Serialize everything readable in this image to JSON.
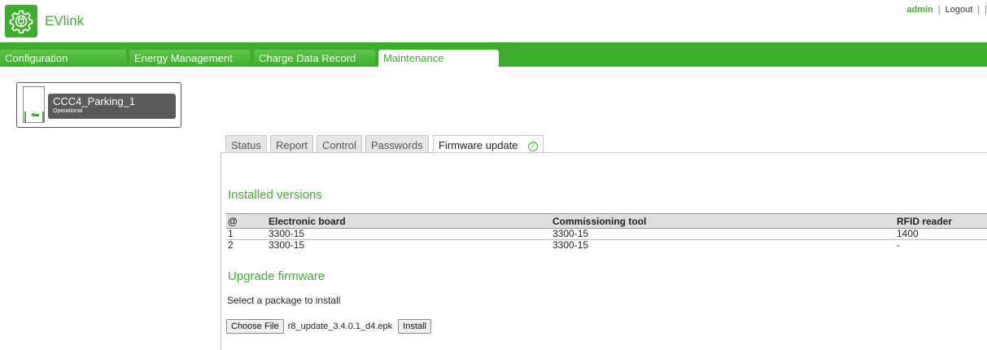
{
  "header": {
    "app_title": "EVlink",
    "user": "admin",
    "logout_label": "Logout",
    "logo_icon": "gear-plug-icon"
  },
  "nav": {
    "tabs": [
      {
        "label": "Configuration"
      },
      {
        "label": "Energy Management"
      },
      {
        "label": "Charge Data Record"
      },
      {
        "label": "Maintenance"
      }
    ],
    "active": "Maintenance"
  },
  "station": {
    "name": "CCC4_Parking_1",
    "status": "Operational",
    "icon": "charger-plug-icon"
  },
  "subtabs": {
    "tabs": [
      {
        "label": "Status"
      },
      {
        "label": "Report"
      },
      {
        "label": "Control"
      },
      {
        "label": "Passwords"
      },
      {
        "label": "Firmware update"
      }
    ],
    "active": "Firmware update",
    "help_icon": "question-circle-icon"
  },
  "installed": {
    "title": "Installed versions",
    "columns": [
      "@",
      "Electronic board",
      "Commissioning tool",
      "RFID reader"
    ],
    "rows": [
      {
        "at": "1",
        "board": "3300-15",
        "tool": "3300-15",
        "rfid": "1400"
      },
      {
        "at": "2",
        "board": "3300-15",
        "tool": "3300-15",
        "rfid": "-"
      }
    ]
  },
  "upgrade": {
    "title": "Upgrade firmware",
    "select_label": "Select a package to install",
    "choose_file_label": "Choose File",
    "file_name": "r8_update_3.4.0.1_d4.epk",
    "install_label": "Install"
  },
  "colors": {
    "brand_green": "#3dae2b",
    "station_label_bg": "#5a5a5a"
  }
}
